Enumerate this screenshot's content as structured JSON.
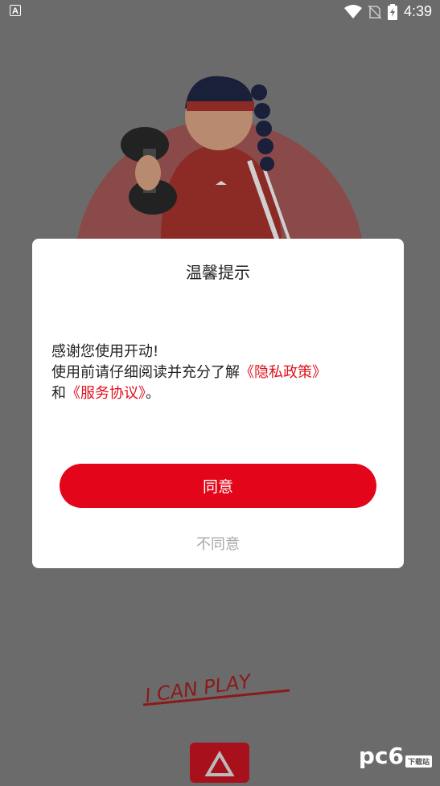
{
  "status_bar": {
    "time": "4:39",
    "left_icon": "A"
  },
  "dialog": {
    "title": "温馨提示",
    "line1": "感谢您使用开动!",
    "line2_prefix": "使用前请仔细阅读并充分了解",
    "privacy_link": "《隐私政策》",
    "line3_prefix": "和",
    "service_link": "《服务协议》",
    "line3_suffix": "。",
    "agree_label": "同意",
    "disagree_label": "不同意"
  },
  "slogan": "I CAN PLAY",
  "watermark": {
    "main": "pc6",
    "sub": "下载站"
  },
  "colors": {
    "accent": "#e3061a",
    "overlay": "#6b6b6b"
  }
}
